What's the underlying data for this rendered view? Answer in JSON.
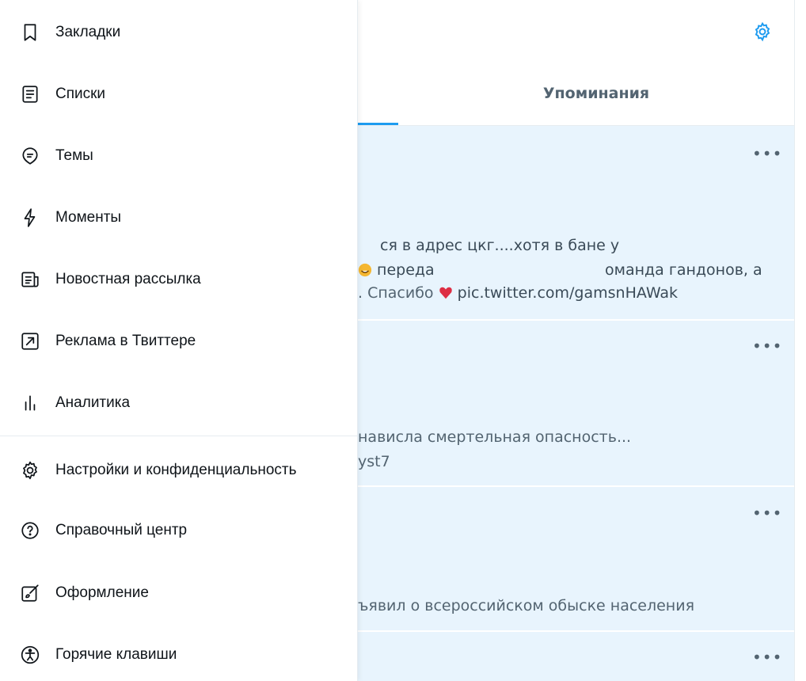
{
  "header": {
    "mentions_tab": "Упоминания"
  },
  "tweets": [
    {
      "line1": "ся в адрес цкг....хотя в бане у",
      "line2": "переда",
      "line2b": "оманда гандонов, а",
      "line3": ". Спасибо",
      "link": "pic.twitter.com/gamsnHAWak"
    },
    {
      "line1": "нависла смертельная опасность...",
      "line2": "yst7"
    },
    {
      "line1": "ъявил о всероссийском обыске населения"
    }
  ],
  "more_label": "•••",
  "menu": {
    "items": [
      {
        "label": "Закладки",
        "icon": "bookmark-icon"
      },
      {
        "label": "Списки",
        "icon": "list-icon"
      },
      {
        "label": "Темы",
        "icon": "topics-icon"
      },
      {
        "label": "Моменты",
        "icon": "lightning-icon"
      },
      {
        "label": "Новостная рассылка",
        "icon": "newsletter-icon"
      },
      {
        "label": "Реклама в Твиттере",
        "icon": "external-arrow-icon"
      },
      {
        "label": "Аналитика",
        "icon": "analytics-icon"
      }
    ],
    "settings_items": [
      {
        "label": "Настройки и конфиденциальность",
        "icon": "gear-icon"
      },
      {
        "label": "Справочный центр",
        "icon": "help-icon"
      },
      {
        "label": "Оформление",
        "icon": "brush-icon"
      },
      {
        "label": "Горячие клавиши",
        "icon": "accessibility-icon"
      }
    ]
  },
  "colors": {
    "accent": "#1d9bf0",
    "timeline_bg": "#e8f4fd",
    "muted_text": "#536471"
  }
}
